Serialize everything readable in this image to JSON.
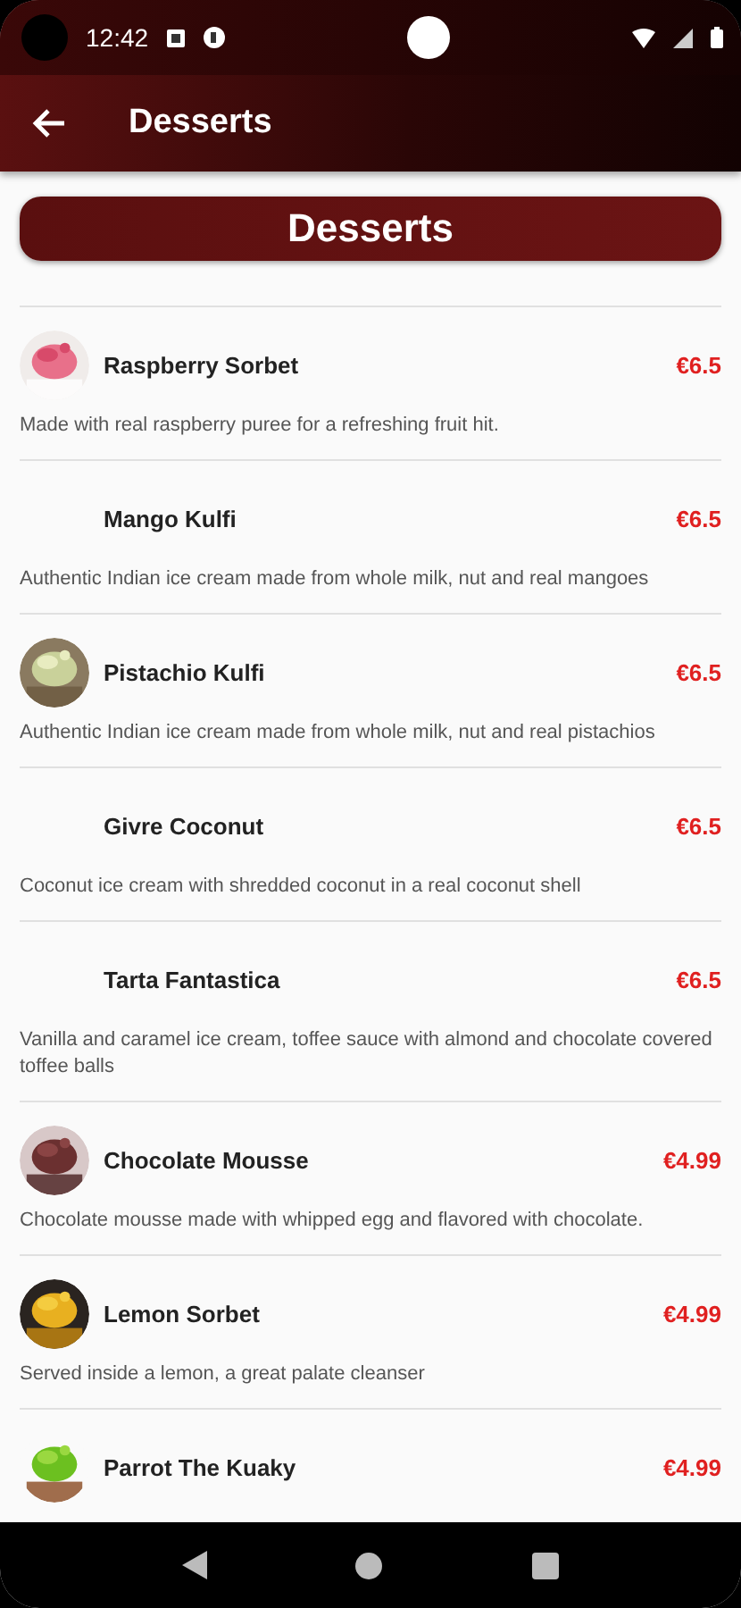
{
  "status_bar": {
    "time": "12:42"
  },
  "app_bar": {
    "title": "Desserts"
  },
  "header": {
    "title": "Desserts"
  },
  "items": [
    {
      "name": "Raspberry Sorbet",
      "price": "€6.5",
      "description": "Made with real raspberry puree for a refreshing fruit hit.",
      "kind": "picture"
    },
    {
      "name": "Mango Kulfi",
      "price": "€6.5",
      "description": "Authentic Indian ice cream made from whole milk, nut and real mangoes",
      "kind": "empty"
    },
    {
      "name": "Pistachio Kulfi",
      "price": "€6.5",
      "description": "Authentic Indian ice cream made from whole milk, nut and real pistachios",
      "kind": "picture"
    },
    {
      "name": "Givre Coconut",
      "price": "€6.5",
      "description": "Coconut ice cream with shredded coconut in a real coconut shell",
      "kind": "empty"
    },
    {
      "name": "Tarta Fantastica",
      "price": "€6.5",
      "description": "Vanilla and caramel ice cream, toffee sauce with almond and chocolate covered toffee balls",
      "kind": "empty"
    },
    {
      "name": "Chocolate Mousse",
      "price": "€4.99",
      "description": "Chocolate mousse made with whipped egg and flavored with chocolate.",
      "kind": "picture"
    },
    {
      "name": "Lemon Sorbet",
      "price": "€4.99",
      "description": "Served inside a lemon, a great palate cleanser",
      "kind": "picture"
    },
    {
      "name": "Parrot The Kuaky",
      "price": "€4.99",
      "kind": "picture"
    }
  ]
}
